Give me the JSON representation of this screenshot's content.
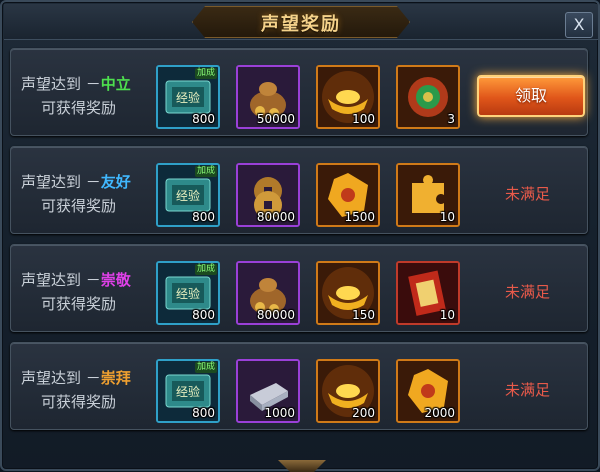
{
  "window": {
    "title": "声望奖励",
    "close_label": "X"
  },
  "common": {
    "reach_prefix": "声望达到 －",
    "reward_line": "可获得奖励",
    "claim_label": "领取",
    "not_met_label": "未满足",
    "exp_badge": "加成"
  },
  "rows": [
    {
      "tier": "中立",
      "tier_color": "#4ee04e",
      "state": "claimable",
      "items": [
        {
          "icon": "exp-scroll-icon",
          "qty": "800"
        },
        {
          "icon": "money-bag-icon",
          "qty": "50000"
        },
        {
          "icon": "gold-ingot-icon",
          "qty": "100"
        },
        {
          "icon": "jade-pendant-icon",
          "qty": "3"
        }
      ]
    },
    {
      "tier": "友好",
      "tier_color": "#40b8ff",
      "state": "not_met",
      "items": [
        {
          "icon": "exp-scroll-icon",
          "qty": "800"
        },
        {
          "icon": "copper-coins-icon",
          "qty": "80000"
        },
        {
          "icon": "gold-rune-stone-icon",
          "qty": "1500"
        },
        {
          "icon": "puzzle-piece-icon",
          "qty": "10"
        }
      ]
    },
    {
      "tier": "崇敬",
      "tier_color": "#e040e8",
      "state": "not_met",
      "items": [
        {
          "icon": "exp-scroll-icon",
          "qty": "800"
        },
        {
          "icon": "money-bag-icon",
          "qty": "80000"
        },
        {
          "icon": "gold-ingot-icon",
          "qty": "150"
        },
        {
          "icon": "red-talisman-icon",
          "qty": "10"
        }
      ]
    },
    {
      "tier": "崇拜",
      "tier_color": "#f0a030",
      "state": "not_met",
      "items": [
        {
          "icon": "exp-scroll-icon",
          "qty": "800"
        },
        {
          "icon": "silver-ingot-icon",
          "qty": "1000"
        },
        {
          "icon": "gold-ingot-icon",
          "qty": "200"
        },
        {
          "icon": "gold-rune-stone-icon",
          "qty": "2000"
        }
      ]
    }
  ]
}
